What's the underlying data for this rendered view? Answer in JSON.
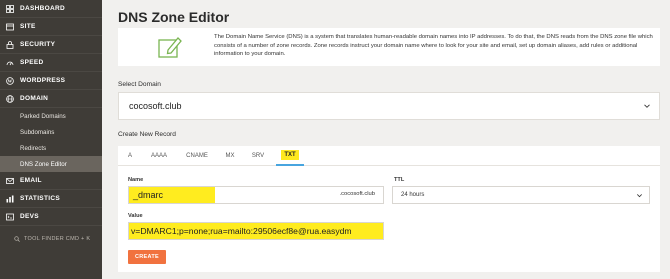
{
  "sidebar": {
    "items": [
      {
        "label": "DASHBOARD",
        "icon": "dashboard-icon"
      },
      {
        "label": "SITE",
        "icon": "site-icon"
      },
      {
        "label": "SECURITY",
        "icon": "lock-icon"
      },
      {
        "label": "SPEED",
        "icon": "speed-icon"
      },
      {
        "label": "WORDPRESS",
        "icon": "wordpress-icon"
      },
      {
        "label": "DOMAIN",
        "icon": "globe-icon"
      }
    ],
    "domain_sub": [
      "Parked Domains",
      "Subdomains",
      "Redirects",
      "DNS Zone Editor"
    ],
    "items_after": [
      {
        "label": "EMAIL",
        "icon": "mail-icon"
      },
      {
        "label": "STATISTICS",
        "icon": "stats-icon"
      },
      {
        "label": "DEVS",
        "icon": "code-icon"
      }
    ],
    "tool_finder": "TOOL FINDER CMD + K"
  },
  "page": {
    "title": "DNS Zone Editor",
    "info": "The Domain Name Service (DNS) is a system that translates human-readable domain names into IP addresses. To do that, the DNS reads from the DNS zone file which consists of a number of zone records. Zone records instruct your domain name where to look for your site and email, set up domain aliases, add rules or additional information to your domain."
  },
  "select_domain": {
    "label": "Select Domain",
    "value": "cocosoft.club"
  },
  "create_record": {
    "label": "Create New Record",
    "tabs": [
      "A",
      "AAAA",
      "CNAME",
      "MX",
      "SRV",
      "TXT"
    ],
    "active_tab": "TXT",
    "name_label": "Name",
    "name_value": "_dmarc",
    "name_suffix": ".cocosoft.club",
    "ttl_label": "TTL",
    "ttl_value": "24 hours",
    "value_label": "Value",
    "value_text": "v=DMARC1;p=none;rua=mailto:29506ecf8e@rua.easydm",
    "create_button": "CREATE"
  },
  "colors": {
    "sidebar": "#3f3c37",
    "accent": "#f1723f",
    "highlight": "#ffec1f",
    "tab_underline": "#48a5df"
  }
}
